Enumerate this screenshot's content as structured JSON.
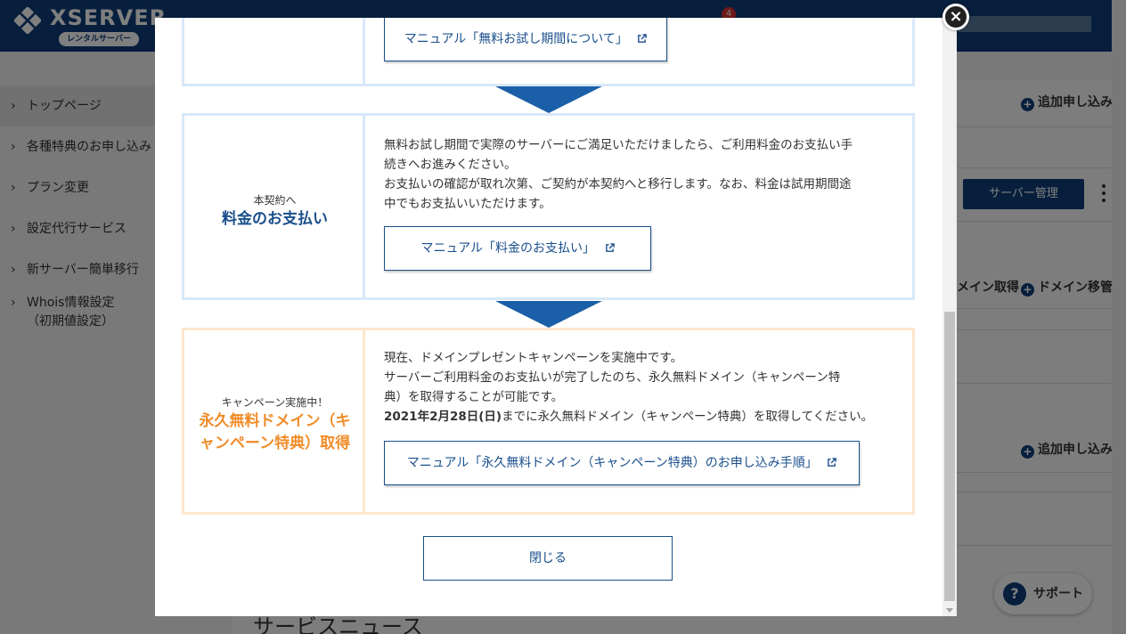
{
  "header": {
    "logo_text": "XSERVER",
    "logo_sub": "レンタルサーバー",
    "notification_count": "4"
  },
  "sidebar": {
    "items": [
      {
        "label": "トップページ"
      },
      {
        "label": "各種特典のお申し込み"
      },
      {
        "label": "プラン変更"
      },
      {
        "label": "設定代行サービス"
      },
      {
        "label": "新サーバー簡単移行"
      },
      {
        "label": "Whois情報設定",
        "sub": "（初期値設定）"
      }
    ]
  },
  "background": {
    "add_application_1": "追加申し込み",
    "server_manage": "サーバー管理",
    "domain_get": "メイン取得",
    "domain_transfer": "ドメイン移管",
    "add_application_2": "追加申し込み",
    "support": "サポート",
    "news_title": "サービスニュース"
  },
  "modal": {
    "step1": {
      "button": "マニュアル「無料お試し期間について」"
    },
    "step2": {
      "sub": "本契約へ",
      "title": "料金のお支払い",
      "lines": [
        "無料お試し期間で実際のサーバーにご満足いただけましたら、ご利用料金のお支払い手",
        "続きへお進みください。",
        "お支払いの確認が取れ次第、ご契約が本契約へと移行します。なお、料金は試用期間途",
        "中でもお支払いいただけます。"
      ],
      "button": "マニュアル「料金のお支払い」"
    },
    "step3": {
      "sub": "キャンペーン実施中！",
      "title_line1": "永久無料ドメイン（キ",
      "title_line2": "ャンペーン特典）取得",
      "lines": [
        "現在、ドメインプレゼントキャンペーンを実施中です。",
        "サーバーご利用料金のお支払いが完了したのち、永久無料ドメイン（キャンペーン特",
        "典）を取得することが可能です。"
      ],
      "deadline_bold": "2021年2月28日(日)",
      "deadline_rest": "までに永久無料ドメイン（キャンペーン特典）を取得してください。",
      "button": "マニュアル「永久無料ドメイン（キャンペーン特典）のお申し込み手順」"
    },
    "close_button": "閉じる"
  },
  "colors": {
    "brand_navy": "#0e3f7a",
    "step_blue": "#1a4f8c",
    "arrow_blue": "#1a5fa8",
    "campaign_orange": "#f08c28",
    "step_border_blue": "#d8e8f8",
    "step_border_orange": "#fde7cc"
  },
  "icons": [
    "external-link-icon",
    "close-icon",
    "plus-circle-icon",
    "chevron-right-icon",
    "question-icon",
    "kebab-menu-icon",
    "logo-mark-icon"
  ]
}
